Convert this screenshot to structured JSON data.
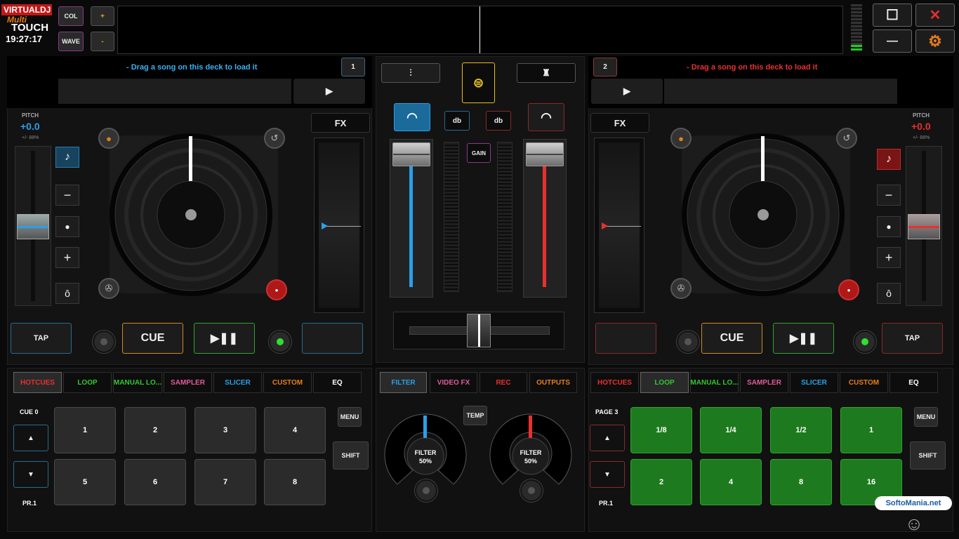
{
  "app": {
    "logo_top": "VIRTUALDJ",
    "logo_mid": "Multi",
    "logo_bottom": "TOUCH",
    "clock": "19:27:17"
  },
  "top_buttons": {
    "col": "COL",
    "wave": "WAVE",
    "plus": "+",
    "minus": "-"
  },
  "window": {
    "maximize": "☐",
    "close": "✕",
    "minimize": "—",
    "settings": "⚙"
  },
  "deck1": {
    "number": "1",
    "drag_text": "- Drag a song on this deck to load it",
    "play_symbol": "▶",
    "pitch_label": "PITCH",
    "pitch_value": "+0.0",
    "pitch_range": "+/- 88%",
    "fx_label": "FX",
    "tap": "TAP",
    "cue": "CUE",
    "play_pause": "▶❚❚",
    "key_minus": "−",
    "key_dot": "●",
    "key_plus": "+",
    "key_lock": "ô",
    "accent": "#2aa0e8"
  },
  "deck2": {
    "number": "2",
    "drag_text": "- Drag a song on this deck to load it",
    "play_symbol": "▶",
    "pitch_label": "PITCH",
    "pitch_value": "+0.0",
    "pitch_range": "+/- 88%",
    "fx_label": "FX",
    "tap": "TAP",
    "cue": "CUE",
    "play_pause": "▶❚❚",
    "key_minus": "−",
    "key_dot": "●",
    "key_plus": "+",
    "key_lock": "ô",
    "accent": "#e83030"
  },
  "mixer": {
    "db_left": "db",
    "db_right": "db",
    "gain": "GAIN"
  },
  "left_tabs": [
    "HOTCUES",
    "LOOP",
    "MANUAL LO...",
    "SAMPLER",
    "SLICER",
    "CUSTOM",
    "EQ"
  ],
  "right_tabs": [
    "HOTCUES",
    "LOOP",
    "MANUAL LO...",
    "SAMPLER",
    "SLICER",
    "CUSTOM",
    "EQ"
  ],
  "center_tabs": [
    "FILTER",
    "VIDEO FX",
    "REC",
    "OUTPUTS"
  ],
  "left_pads_panel": {
    "label": "CUE 0",
    "up": "▲",
    "down": "▼",
    "preset": "PR.1",
    "menu": "MENU",
    "shift": "SHIFT",
    "pads": [
      "1",
      "2",
      "3",
      "4",
      "5",
      "6",
      "7",
      "8"
    ]
  },
  "right_pads_panel": {
    "label": "PAGE 3",
    "up": "▲",
    "down": "▼",
    "preset": "PR.1",
    "menu": "MENU",
    "shift": "SHIFT",
    "pads": [
      "1/8",
      "1/4",
      "1/2",
      "1",
      "2",
      "4",
      "8",
      "16"
    ]
  },
  "filter": {
    "temp": "TEMP",
    "left_label": "FILTER",
    "left_value": "50%",
    "right_label": "FILTER",
    "right_value": "50%"
  },
  "watermark": "SoftoMania.net"
}
